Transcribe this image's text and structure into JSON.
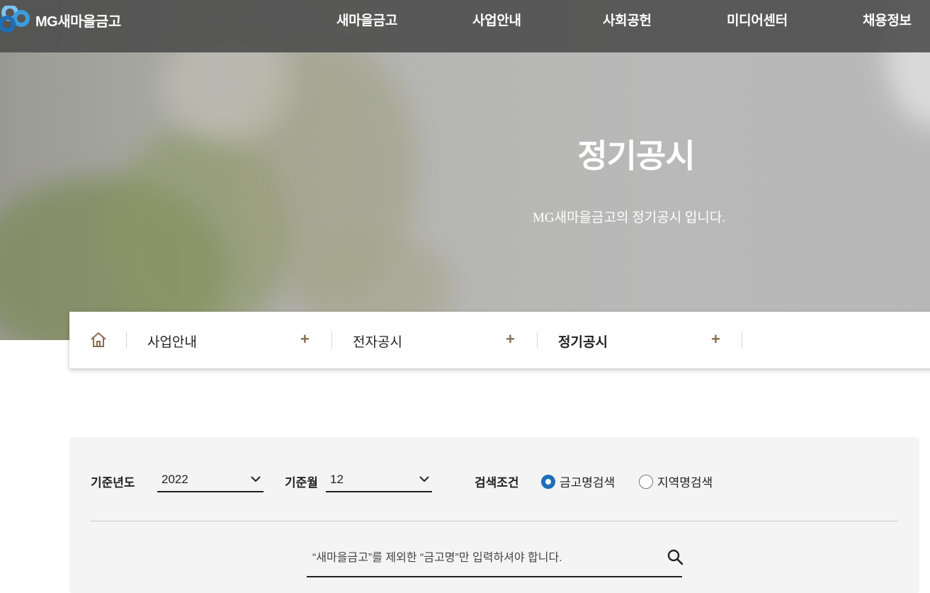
{
  "brand": {
    "logo_text": "MG새마을금고"
  },
  "nav": {
    "items": [
      "새마을금고",
      "사업안내",
      "사회공헌",
      "미디어센터",
      "채용정보"
    ]
  },
  "hero": {
    "title": "정기공시",
    "subtitle": "MG새마을금고의 정기공시 입니다."
  },
  "breadcrumb": {
    "items": [
      "사업안내",
      "전자공시",
      "정기공시"
    ],
    "expand_glyph": "+"
  },
  "search": {
    "year_label": "기준년도",
    "year_value": "2022",
    "month_label": "기준월",
    "month_value": "12",
    "condition_label": "검색조건",
    "options": [
      {
        "label": "금고명검색",
        "selected": true
      },
      {
        "label": "지역명검색",
        "selected": false
      }
    ],
    "placeholder": "“새마을금고”를 제외한 “금고명”만 입력하셔야 합니다."
  },
  "colors": {
    "accent": "#1d6fb8",
    "plus": "#8a6d52",
    "nav_bg": "#4b4b4b",
    "panel_bg": "#f4f4f4"
  }
}
